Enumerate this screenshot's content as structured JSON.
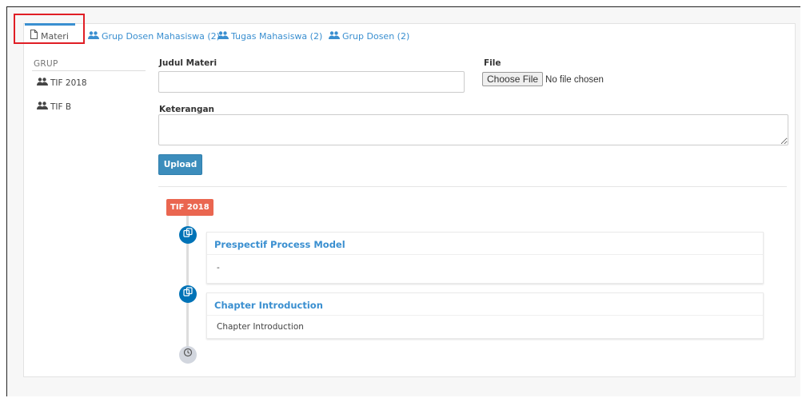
{
  "tabs": [
    {
      "label": "Materi",
      "icon": "file-icon",
      "active": true
    },
    {
      "label": "Grup Dosen Mahasiswa (2)",
      "icon": "users-icon"
    },
    {
      "label": "Tugas Mahasiswa (2)",
      "icon": "users-icon"
    },
    {
      "label": "Grup Dosen (2)",
      "icon": "users-icon"
    }
  ],
  "sidebar": {
    "heading": "GRUP",
    "items": [
      {
        "label": "TIF 2018",
        "icon": "users-icon"
      },
      {
        "label": "TIF B",
        "icon": "users-icon"
      }
    ]
  },
  "form": {
    "judul_label": "Judul Materi",
    "judul_value": "",
    "file_label": "File",
    "file_button": "Choose File",
    "file_status": "No file chosen",
    "keterangan_label": "Keterangan",
    "keterangan_value": "",
    "upload_label": "Upload"
  },
  "timeline": {
    "group_label": "TIF 2018",
    "items": [
      {
        "title": "Prespectif Process Model",
        "body": "-",
        "icon": "copy-icon"
      },
      {
        "title": "Chapter Introduction",
        "body": "Chapter Introduction",
        "icon": "copy-icon"
      }
    ],
    "end_icon": "clock-icon"
  },
  "colors": {
    "accent": "#3a8fd0",
    "upload_button": "#3c8dbc",
    "timeline_label": "#ea6650",
    "timeline_dot": "#0073b7",
    "highlight": "#e01e25"
  }
}
